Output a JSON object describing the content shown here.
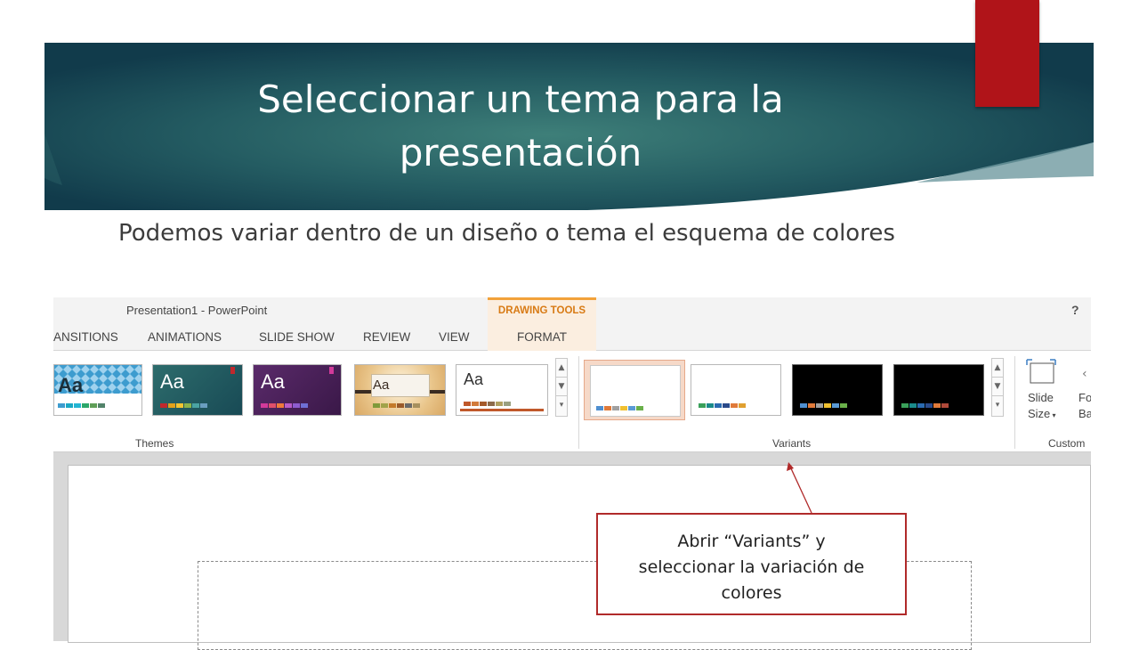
{
  "slide": {
    "title": "Seleccionar un tema para la presentación",
    "body": "Podemos variar dentro de un diseño o tema el esquema de colores",
    "banner_color": "#1e4f57",
    "accent_tab_color": "#b01419"
  },
  "ppt": {
    "window_title": "Presentation1 - PowerPoint",
    "help": "?",
    "contextual_group": "DRAWING TOOLS",
    "tabs": [
      "ANSITIONS",
      "ANIMATIONS",
      "SLIDE SHOW",
      "REVIEW",
      "VIEW",
      "FORMAT"
    ],
    "themes_label": "Themes",
    "variants_label": "Variants",
    "customize_label": "Custom",
    "slide_size_label_1": "Slide",
    "slide_size_label_2": "Size",
    "format_bg_label_1": "Fo",
    "format_bg_label_2": "Bacl",
    "theme_thumb_text": "Aa"
  },
  "callout": {
    "line1": "Abrir “Variants” y",
    "line2": "seleccionar la variación de",
    "line3": "colores",
    "border_color": "#b02a2a"
  }
}
